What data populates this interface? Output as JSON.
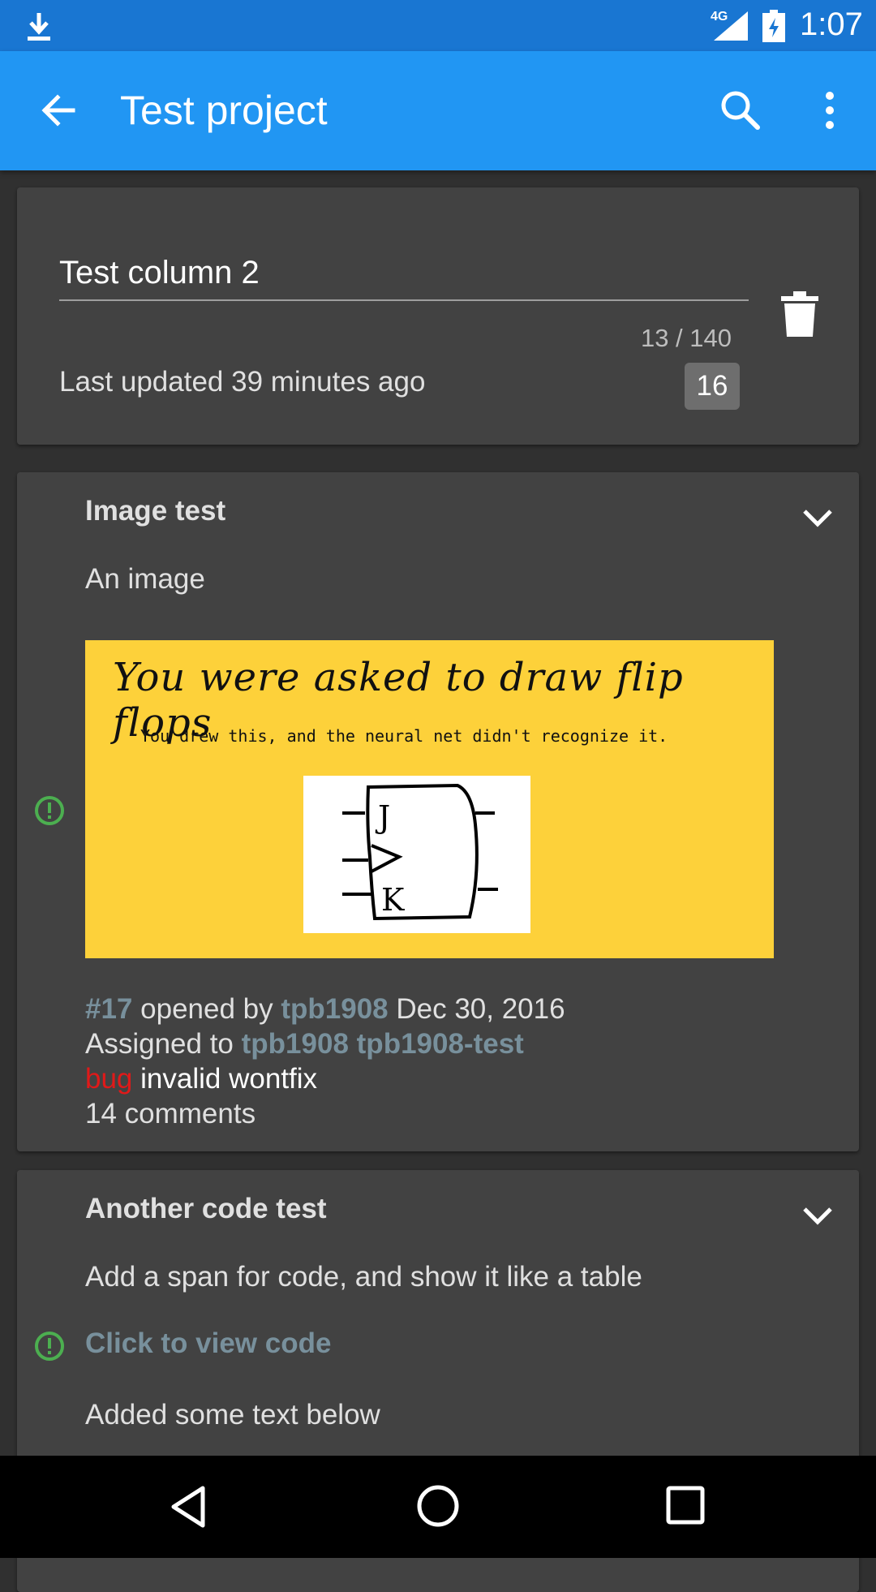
{
  "status_bar": {
    "network": "4G",
    "time": "1:07",
    "download_icon": "download-icon",
    "signal_icon": "signal-icon",
    "battery_icon": "battery-charging-icon"
  },
  "app_bar": {
    "title": "Test project",
    "back_icon": "arrow-back-icon",
    "search_icon": "search-icon",
    "more_icon": "more-vert-icon",
    "color": "#2196f3"
  },
  "column": {
    "name": "Test column 2",
    "char_count": "13 / 140",
    "last_updated": "Last updated 39 minutes ago",
    "card_count": "16"
  },
  "issues": [
    {
      "title": "Image test",
      "body": "An image",
      "state_icon": "issue-open-icon",
      "state_color": "#4caf50",
      "image": {
        "heading": "You were asked to draw flip flops",
        "subtext": "You drew this, and the neural net didn't recognize it.",
        "drawing_labels": [
          "J",
          "K"
        ]
      },
      "number": "#17",
      "opened_by_text": "opened by",
      "author": "tpb1908",
      "date": "Dec 30, 2016",
      "assigned_text": "Assigned to",
      "assignees": [
        "tpb1908",
        "tpb1908-test"
      ],
      "labels": [
        "bug",
        "invalid",
        "wontfix"
      ],
      "comments": "14 comments"
    },
    {
      "title": "Another code test",
      "body": "Add a span for code, and show it like a table",
      "state_icon": "issue-open-icon",
      "code_link": "Click to view code",
      "extra_text": "Added some text below"
    }
  ],
  "nav_bar": {
    "back_icon": "nav-back-icon",
    "home_icon": "nav-home-icon",
    "recents_icon": "nav-recents-icon"
  }
}
